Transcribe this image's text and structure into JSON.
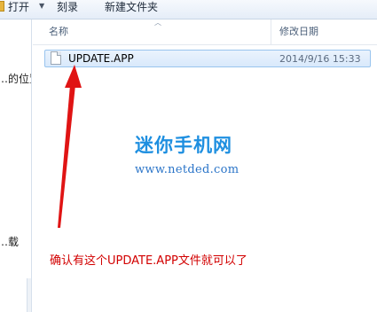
{
  "toolbar": {
    "open_label": "打开",
    "burn_label": "刻录",
    "new_folder_label": "新建文件夹",
    "open_icon": "folder-icon",
    "dropdown_icon": "chevron-down-icon"
  },
  "nav_pane": {
    "fragment_1": "…的位置",
    "fragment_2": "…载"
  },
  "columns": {
    "name": "名称",
    "modified": "修改日期"
  },
  "files": [
    {
      "name": "UPDATE.APP",
      "modified": "2014/9/16 15:33",
      "icon": "file-icon"
    }
  ],
  "watermark": {
    "title": "迷你手机网",
    "url": "www.netded.com",
    "color": "#1e8fe0"
  },
  "annotation": {
    "text": "确认有这个UPDATE.APP文件就可以了",
    "color": "#d20000"
  }
}
